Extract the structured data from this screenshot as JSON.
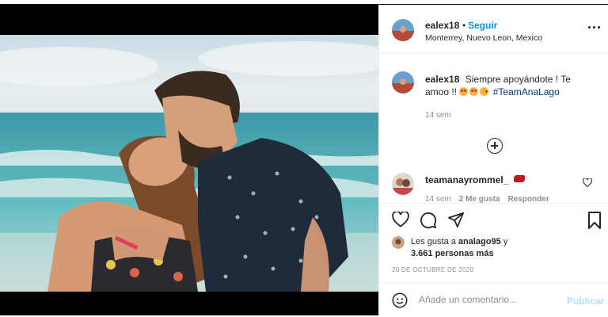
{
  "post": {
    "author": {
      "username": "ealex18",
      "separator": "•",
      "follow_label": "Seguir",
      "location": "Monterrey, Nuevo Leon, Mexico"
    },
    "caption": {
      "username": "ealex18",
      "text": "Siempre apoyándote ! Te amoo !!",
      "emojis": [
        "heart-eyes-emoji",
        "heart-eyes-emoji",
        "kiss-emoji"
      ],
      "hashtag": "#TeamAnaLago",
      "time": "14 sem"
    },
    "comments": [
      {
        "username": "teamanayrommel_",
        "emoji": "lips-emoji",
        "time": "14 sem",
        "likes_label": "2 Me gusta",
        "reply_label": "Responder"
      }
    ],
    "likes": {
      "prefix": "Les gusta a",
      "user": "analago95",
      "connector": "y",
      "count_label": "3.661 personas más"
    },
    "date": "20 DE OCTUBRE DE 2020",
    "comment_box": {
      "placeholder": "Añade un comentario...",
      "publish_label": "Publicar"
    }
  },
  "colors": {
    "accent": "#0095f6",
    "publish_disabled": "#b2dffc",
    "hashtag": "#00376b",
    "muted": "#8e8e8e",
    "text": "#262626"
  },
  "icons": [
    "more-options-icon",
    "add-circle-icon",
    "heart-icon",
    "comment-icon",
    "share-icon",
    "bookmark-icon",
    "smiley-icon"
  ]
}
